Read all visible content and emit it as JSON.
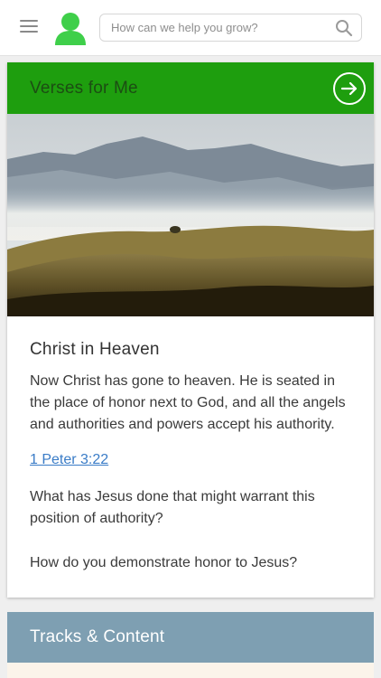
{
  "header": {
    "menu_icon": "hamburger-menu-icon",
    "avatar_icon": "user-avatar-icon",
    "search": {
      "placeholder": "How can we help you grow?",
      "icon": "search-icon"
    }
  },
  "verse_card": {
    "header_title": "Verses for Me",
    "header_color": "#1e9e0e",
    "arrow_icon": "arrow-right-circle-icon",
    "image": "mountain-landscape-photo",
    "title": "Christ in Heaven",
    "text": "Now Christ has gone to heaven. He is seated in the place of honor next to God, and all the angels and authorities and powers accept his authority.",
    "reference": "1 Peter 3:22",
    "questions": [
      "What has Jesus done that might warrant this position of authority?",
      "How do you demonstrate honor to Jesus?"
    ]
  },
  "tracks": {
    "title": "Tracks & Content",
    "color": "#7e9fb2"
  }
}
